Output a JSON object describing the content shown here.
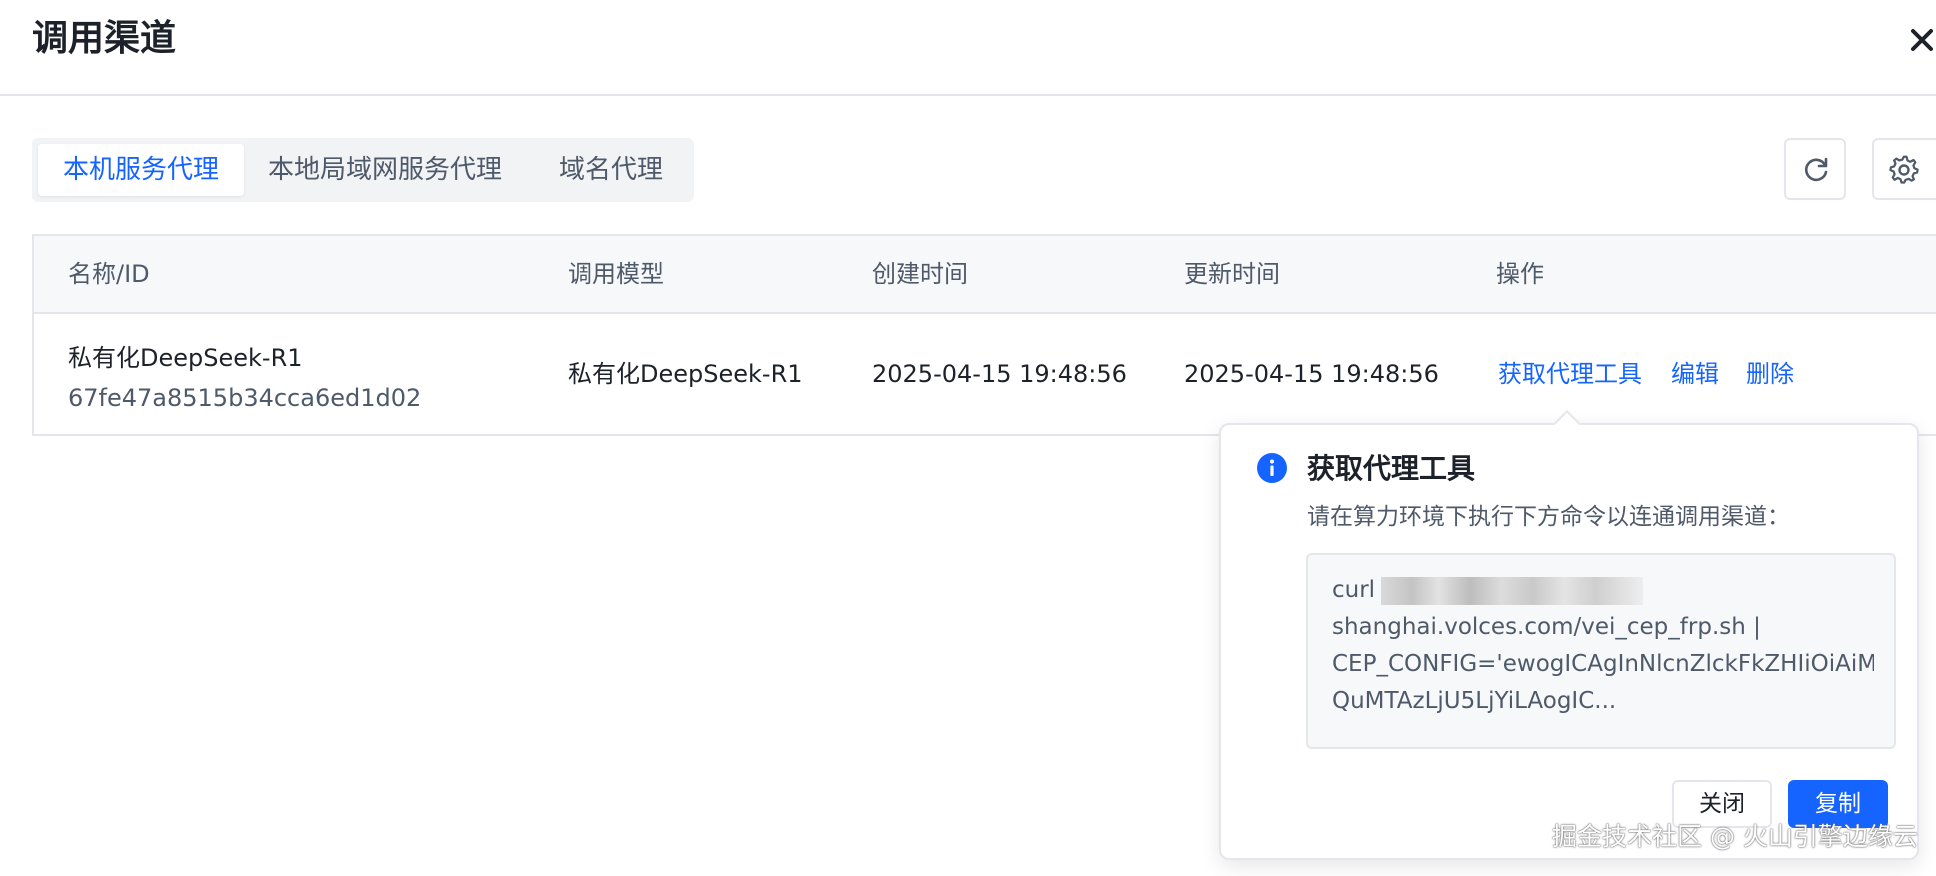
{
  "dialog": {
    "title": "调用渠道"
  },
  "tabs": [
    {
      "label": "本机服务代理",
      "active": true
    },
    {
      "label": "本地局域网服务代理",
      "active": false
    },
    {
      "label": "域名代理",
      "active": false
    }
  ],
  "toolbar": {
    "refresh_icon": "refresh-icon",
    "settings_icon": "gear-icon"
  },
  "table": {
    "columns": [
      "名称/ID",
      "调用模型",
      "创建时间",
      "更新时间",
      "操作"
    ],
    "rows": [
      {
        "name": "私有化DeepSeek-R1",
        "id": "67fe47a8515b34cca6ed1d02",
        "model": "私有化DeepSeek-R1",
        "created": "2025-04-15 19:48:56",
        "updated": "2025-04-15 19:48:56",
        "actions": [
          "获取代理工具",
          "编辑",
          "删除"
        ]
      }
    ]
  },
  "popover": {
    "title": "获取代理工具",
    "description": "请在算力环境下执行下方命令以连通调用渠道：",
    "command_lines": [
      "curl",
      "shanghai.volces.com/vei_cep_frp.sh |",
      "CEP_CONFIG='ewogICAgInNlcnZlckFkZHIiOiAiMT",
      "QuMTAzLjU5LjYiLAogIC..."
    ],
    "close_label": "关闭",
    "copy_label": "复制"
  },
  "colors": {
    "accent": "#1664ff",
    "text": "#1d2129",
    "muted": "#4e5969",
    "border": "#e5e6eb"
  },
  "watermark": "掘金技术社区 @ 火山引擎边缘云"
}
